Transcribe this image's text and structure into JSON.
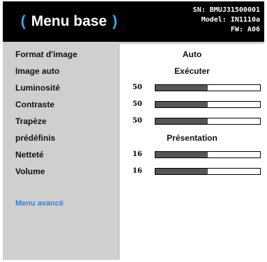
{
  "header": {
    "paren_open": "(",
    "title": "Menu base",
    "paren_close": ")",
    "sn": "SN: BMUJ31500001",
    "model": "Model: IN1110a",
    "fw": "FW: A06"
  },
  "menu": [
    {
      "label": "Format d'image",
      "display": "Auto"
    },
    {
      "label": "Image auto",
      "display": "Exécuter"
    },
    {
      "label": "Luminosité",
      "value": "50",
      "level": 0.5
    },
    {
      "label": "Contraste",
      "value": "50",
      "level": 0.5
    },
    {
      "label": "Trapèze",
      "value": "50",
      "level": 0.5
    },
    {
      "label": "prédéfinis",
      "display": "Présentation"
    },
    {
      "label": "Netteté",
      "value": "16",
      "level": 0.5
    },
    {
      "label": "Volume",
      "value": "16",
      "level": 0.5
    }
  ],
  "advanced_label": "Menu avancé",
  "colors": {
    "accent": "#2bb0ff",
    "link": "#3d7dde",
    "header_bg": "#000000",
    "panel_bg": "#cfcfcf",
    "bar_fill": "#555555"
  }
}
